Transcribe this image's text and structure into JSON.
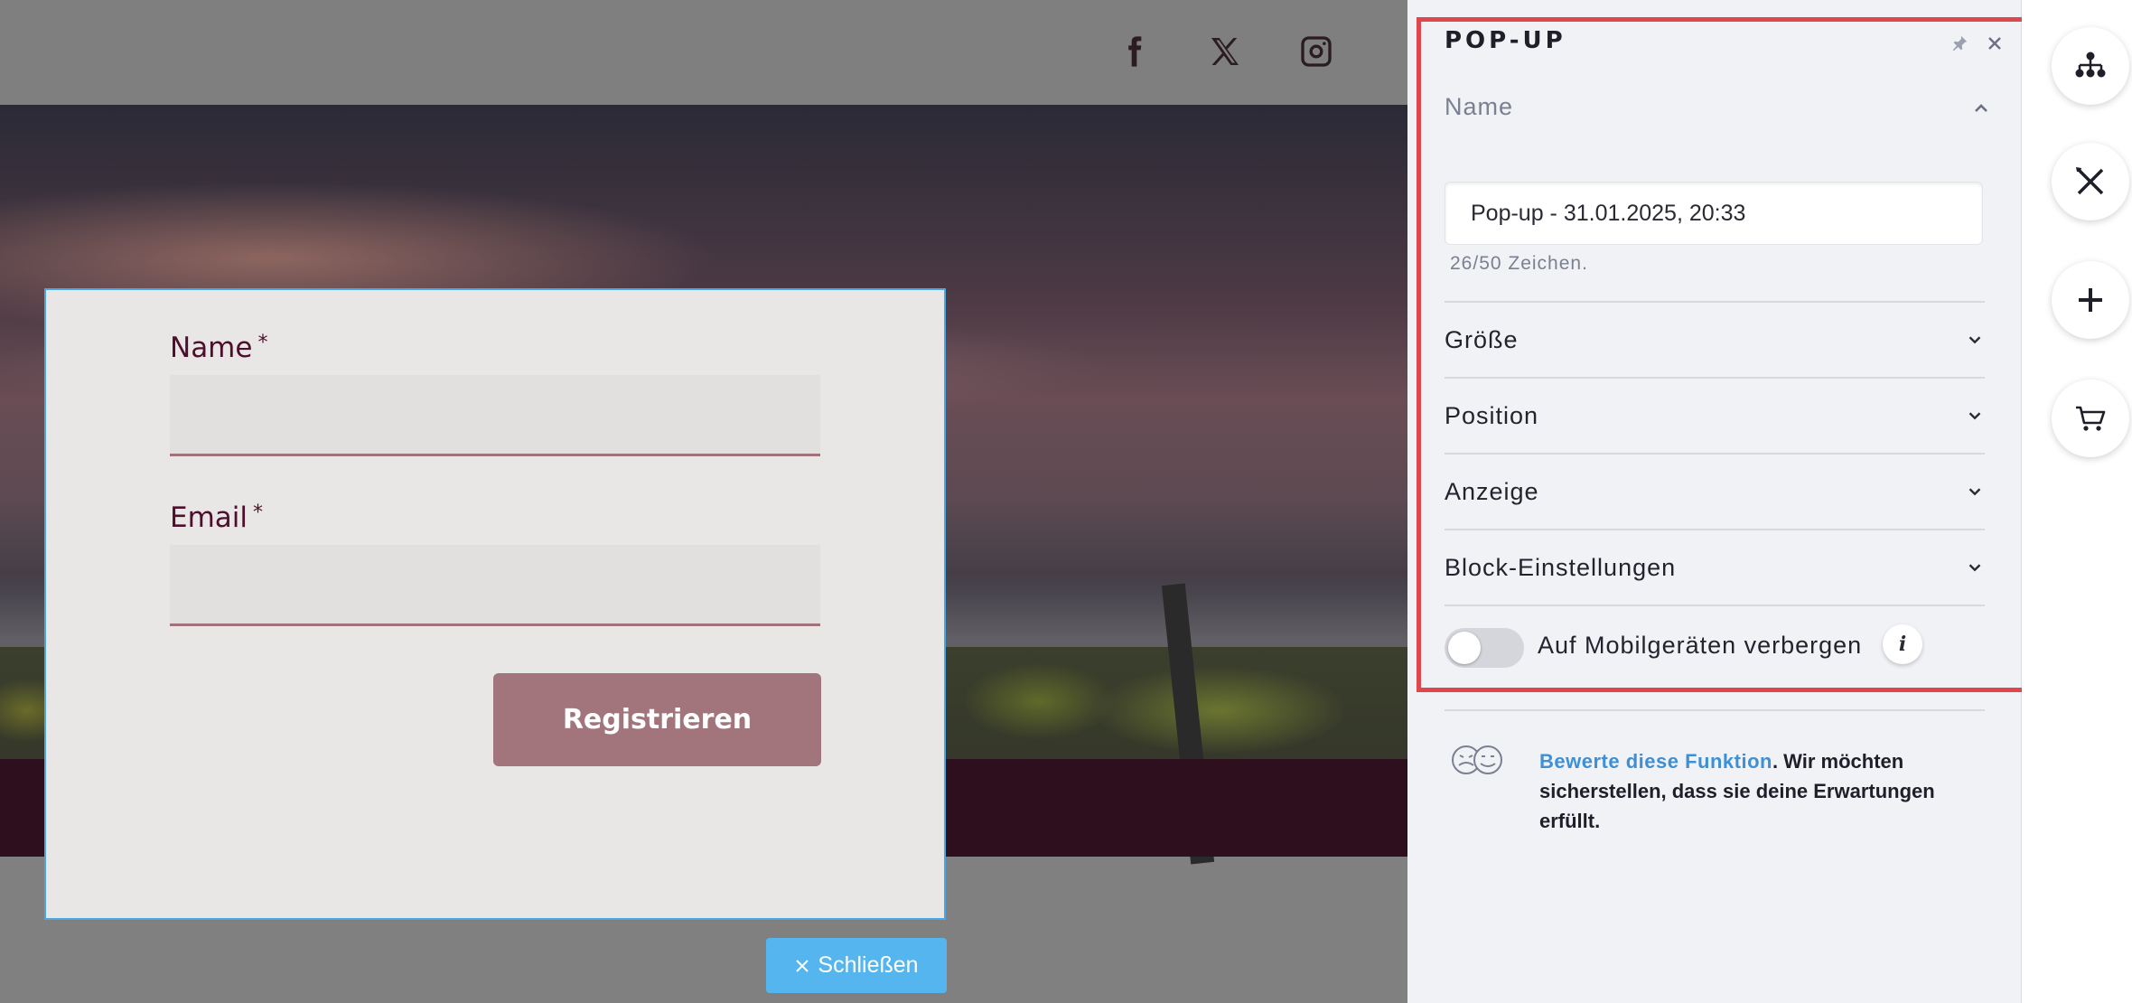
{
  "social": {
    "facebook_icon": "facebook-icon",
    "x_icon": "x-icon",
    "instagram_icon": "instagram-icon"
  },
  "popup": {
    "name_label": "Name",
    "email_label": "Email",
    "required_mark": "*",
    "register_label": "Registrieren",
    "close_label": "Schließen"
  },
  "panel": {
    "title": "POP-UP",
    "name_section": "Name",
    "name_value": "Pop-up - 31.01.2025, 20:33",
    "char_count": "26/50 Zeichen.",
    "sections": [
      {
        "label": "Größe"
      },
      {
        "label": "Position"
      },
      {
        "label": "Anzeige"
      },
      {
        "label": "Block-Einstellungen"
      }
    ],
    "hide_mobile_label": "Auf Mobilgeräten verbergen",
    "hide_mobile_enabled": false,
    "info_glyph": "i",
    "feedback_link": "Bewerte diese Funktion",
    "feedback_text": ". Wir möchten sicherstellen, dass sie deine Erwartungen erfüllt."
  },
  "colors": {
    "accent_blue": "#4ba6e6",
    "close_button": "#55b5ee",
    "register_button": "#a2747c",
    "label_color": "#4d0f2d",
    "highlight_frame": "#e0474c",
    "footer_band": "#2e0f1e"
  },
  "toolbar": {
    "icons": [
      "sitemap-icon",
      "tools-icon",
      "plus-icon",
      "cart-icon"
    ]
  }
}
